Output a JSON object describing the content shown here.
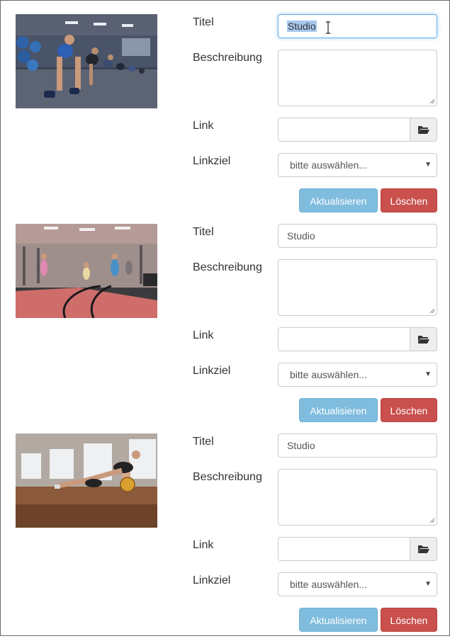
{
  "labels": {
    "title": "Titel",
    "description": "Beschreibung",
    "link": "Link",
    "target": "Linkziel"
  },
  "items": [
    {
      "image_icon": "gym-pushup-class-photo",
      "title_value": "Studio",
      "title_selected": true,
      "description_value": "",
      "link_value": "",
      "target_value": "bitte auswählen...",
      "update_label": "Aktualisieren",
      "delete_label": "Löschen"
    },
    {
      "image_icon": "gym-battle-ropes-photo",
      "title_value": "Studio",
      "description_value": "",
      "link_value": "",
      "target_value": "bitte auswählen...",
      "update_label": "Aktualisieren",
      "delete_label": "Löschen"
    },
    {
      "image_icon": "gym-medicine-ball-photo",
      "title_value": "Studio",
      "description_value": "",
      "link_value": "",
      "target_value": "bitte auswählen...",
      "update_label": "Aktualisieren",
      "delete_label": "Löschen"
    }
  ],
  "colors": {
    "update_button": "#7fbcde",
    "delete_button": "#c9504d",
    "focus_border": "#66afe9"
  }
}
